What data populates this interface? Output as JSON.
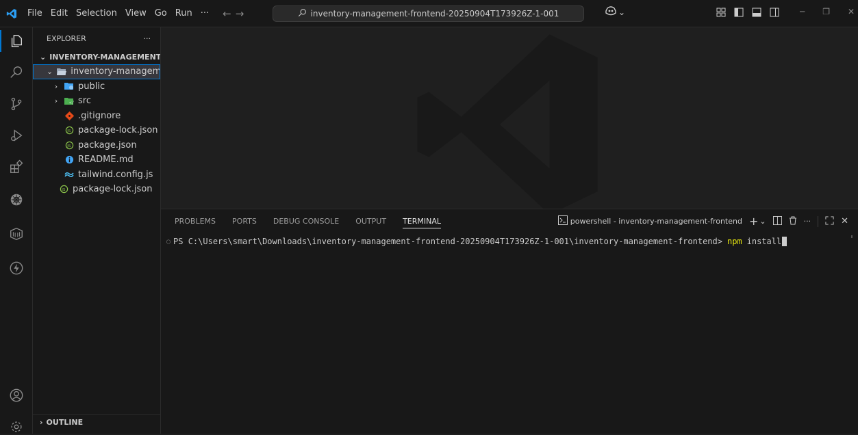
{
  "menu": [
    "File",
    "Edit",
    "Selection",
    "View",
    "Go",
    "Run",
    "···"
  ],
  "search": {
    "text": "inventory-management-frontend-20250904T173926Z-1-001"
  },
  "explorer": {
    "header": "EXPLORER",
    "more": "···",
    "root": "INVENTORY-MANAGEMENT-...",
    "tree": [
      {
        "label": "inventory-managem...",
        "type": "folder-open",
        "depth": 1
      },
      {
        "label": "public",
        "type": "folder",
        "depth": 2
      },
      {
        "label": "src",
        "type": "folder",
        "depth": 2
      },
      {
        "label": ".gitignore",
        "type": "git",
        "depth": 2
      },
      {
        "label": "package-lock.json",
        "type": "npm",
        "depth": 2
      },
      {
        "label": "package.json",
        "type": "npm",
        "depth": 2
      },
      {
        "label": "README.md",
        "type": "info",
        "depth": 2
      },
      {
        "label": "tailwind.config.js",
        "type": "tailwind",
        "depth": 2
      },
      {
        "label": "package-lock.json",
        "type": "npm",
        "depth": 1
      }
    ],
    "outline": "OUTLINE"
  },
  "panel": {
    "tabs": [
      "PROBLEMS",
      "PORTS",
      "DEBUG CONSOLE",
      "OUTPUT",
      "TERMINAL"
    ],
    "active_tab": "TERMINAL",
    "terminal_name": "powershell - inventory-management-frontend"
  },
  "terminal": {
    "prompt": "PS C:\\Users\\smart\\Downloads\\inventory-management-frontend-20250904T173926Z-1-001\\inventory-management-frontend>",
    "command": "npm",
    "argument": "install"
  },
  "colors": {
    "accent": "#0078d4",
    "command": "#e5e510",
    "background": "#1f1f1f",
    "sidebar": "#181818"
  }
}
